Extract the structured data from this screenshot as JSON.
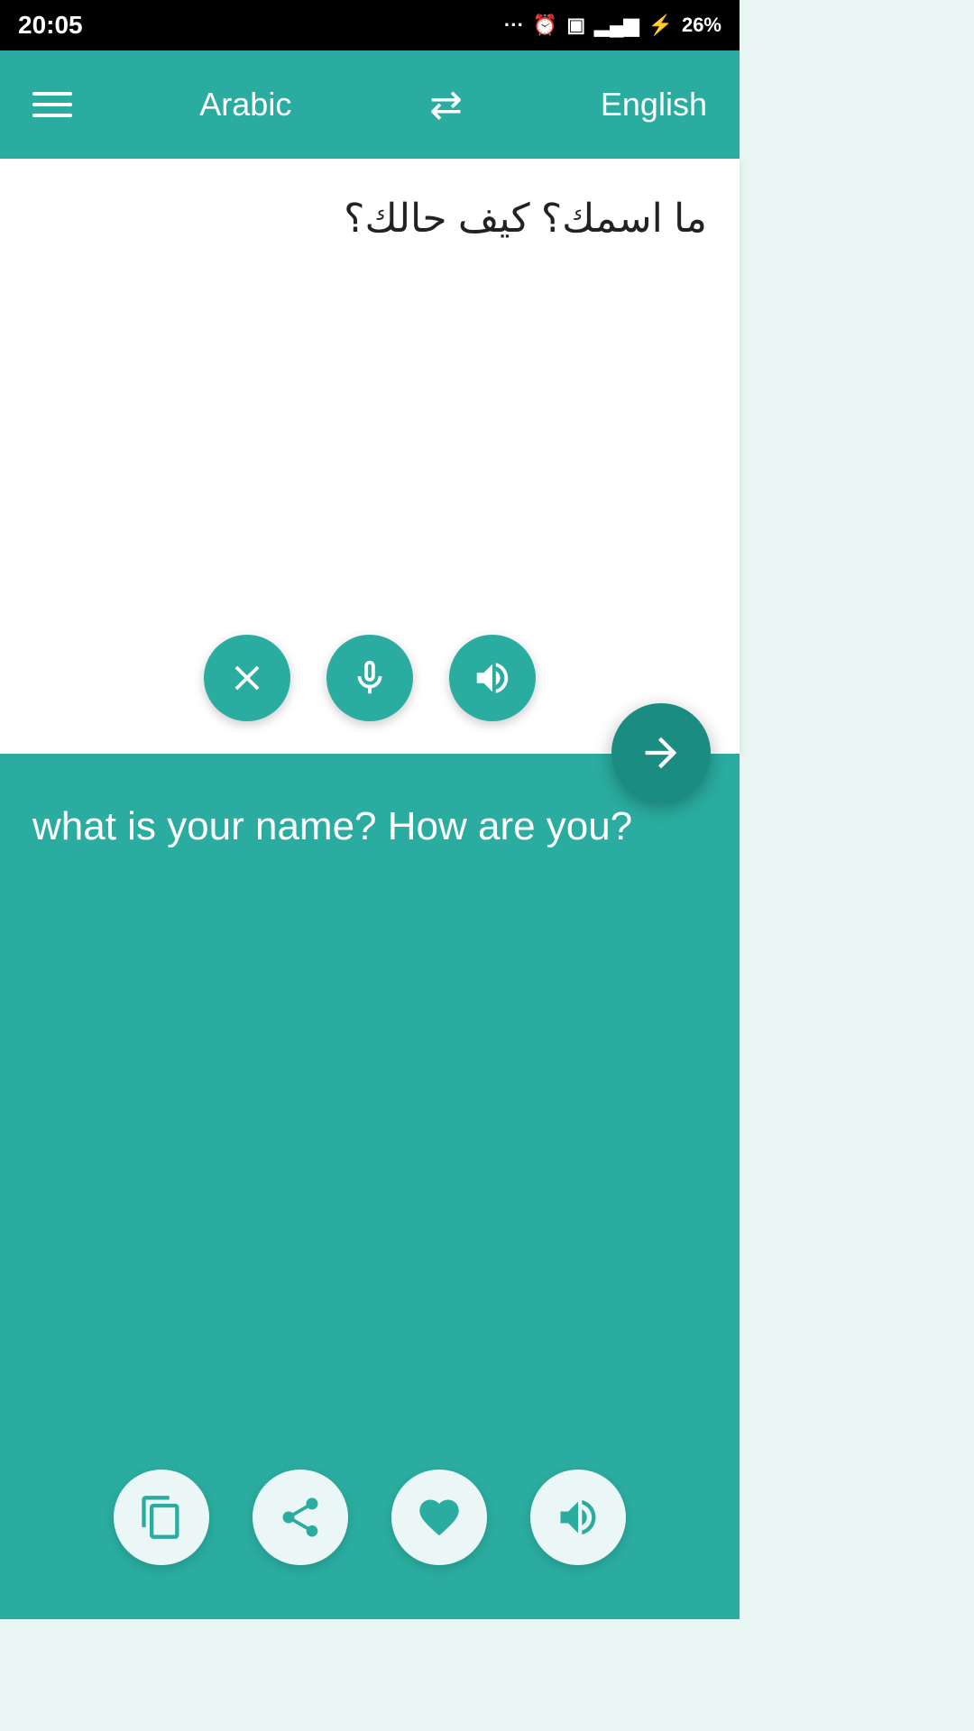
{
  "statusBar": {
    "time": "20:05",
    "battery": "26%"
  },
  "toolbar": {
    "menuLabel": "menu",
    "sourceLang": "Arabic",
    "swapLabel": "swap languages",
    "targetLang": "English"
  },
  "sourcePanel": {
    "inputText": "ما اسمك؟ كيف حالك؟",
    "clearLabel": "clear",
    "micLabel": "microphone",
    "speakerLabel": "speaker",
    "translateLabel": "translate"
  },
  "outputPanel": {
    "outputText": "what is your name? How are you?",
    "copyLabel": "copy",
    "shareLabel": "share",
    "favoriteLabel": "favorite",
    "speakerLabel": "speaker"
  }
}
